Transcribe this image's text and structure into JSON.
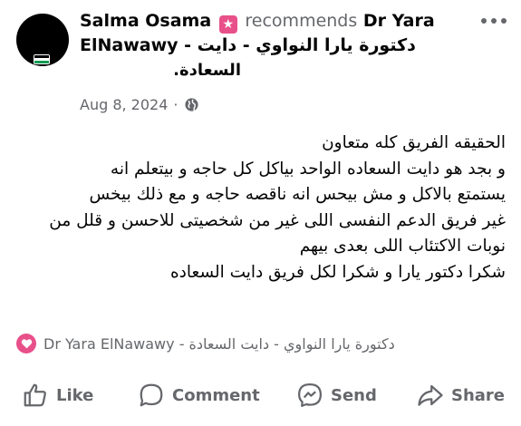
{
  "post": {
    "author": "Salma Osama",
    "verb": "recommends",
    "target_line1": "Dr Yara",
    "target_line2": "ElNawawy - دكتورة يارا النواوي - دايت",
    "target_line3": "السعادة.",
    "date": "Aug 8, 2024",
    "separator": "·",
    "body_lines": [
      "الحقيقه الفريق كله متعاون",
      "و بجد هو دايت السعاده الواحد بياكل كل حاجه و بيتعلم انه",
      "يستمتع بالاكل و مش بيحس انه ناقصه حاجه و مع ذلك بيخس",
      "غير فريق الدعم النفسى اللى غير من شخصيتى للاحسن و قلل من",
      "نوبات الاكتئاب اللى بعدى بيهم",
      "شكرا دكتور يارا و شكرا لكل فريق دايت السعاده"
    ],
    "recommendation_page": "Dr Yara ElNawawy - دكتورة يارا النواوي - دايت السعادة"
  },
  "actions": {
    "like": "Like",
    "comment": "Comment",
    "send": "Send",
    "share": "Share"
  },
  "icons": {
    "recommend_badge": "star-badge-icon",
    "privacy": "globe-icon",
    "recommend_heart": "heart-icon",
    "more": "more-options-icon"
  },
  "colors": {
    "accent_pink": "#e8508a",
    "secondary_text": "#65676b",
    "primary_text": "#050505"
  }
}
